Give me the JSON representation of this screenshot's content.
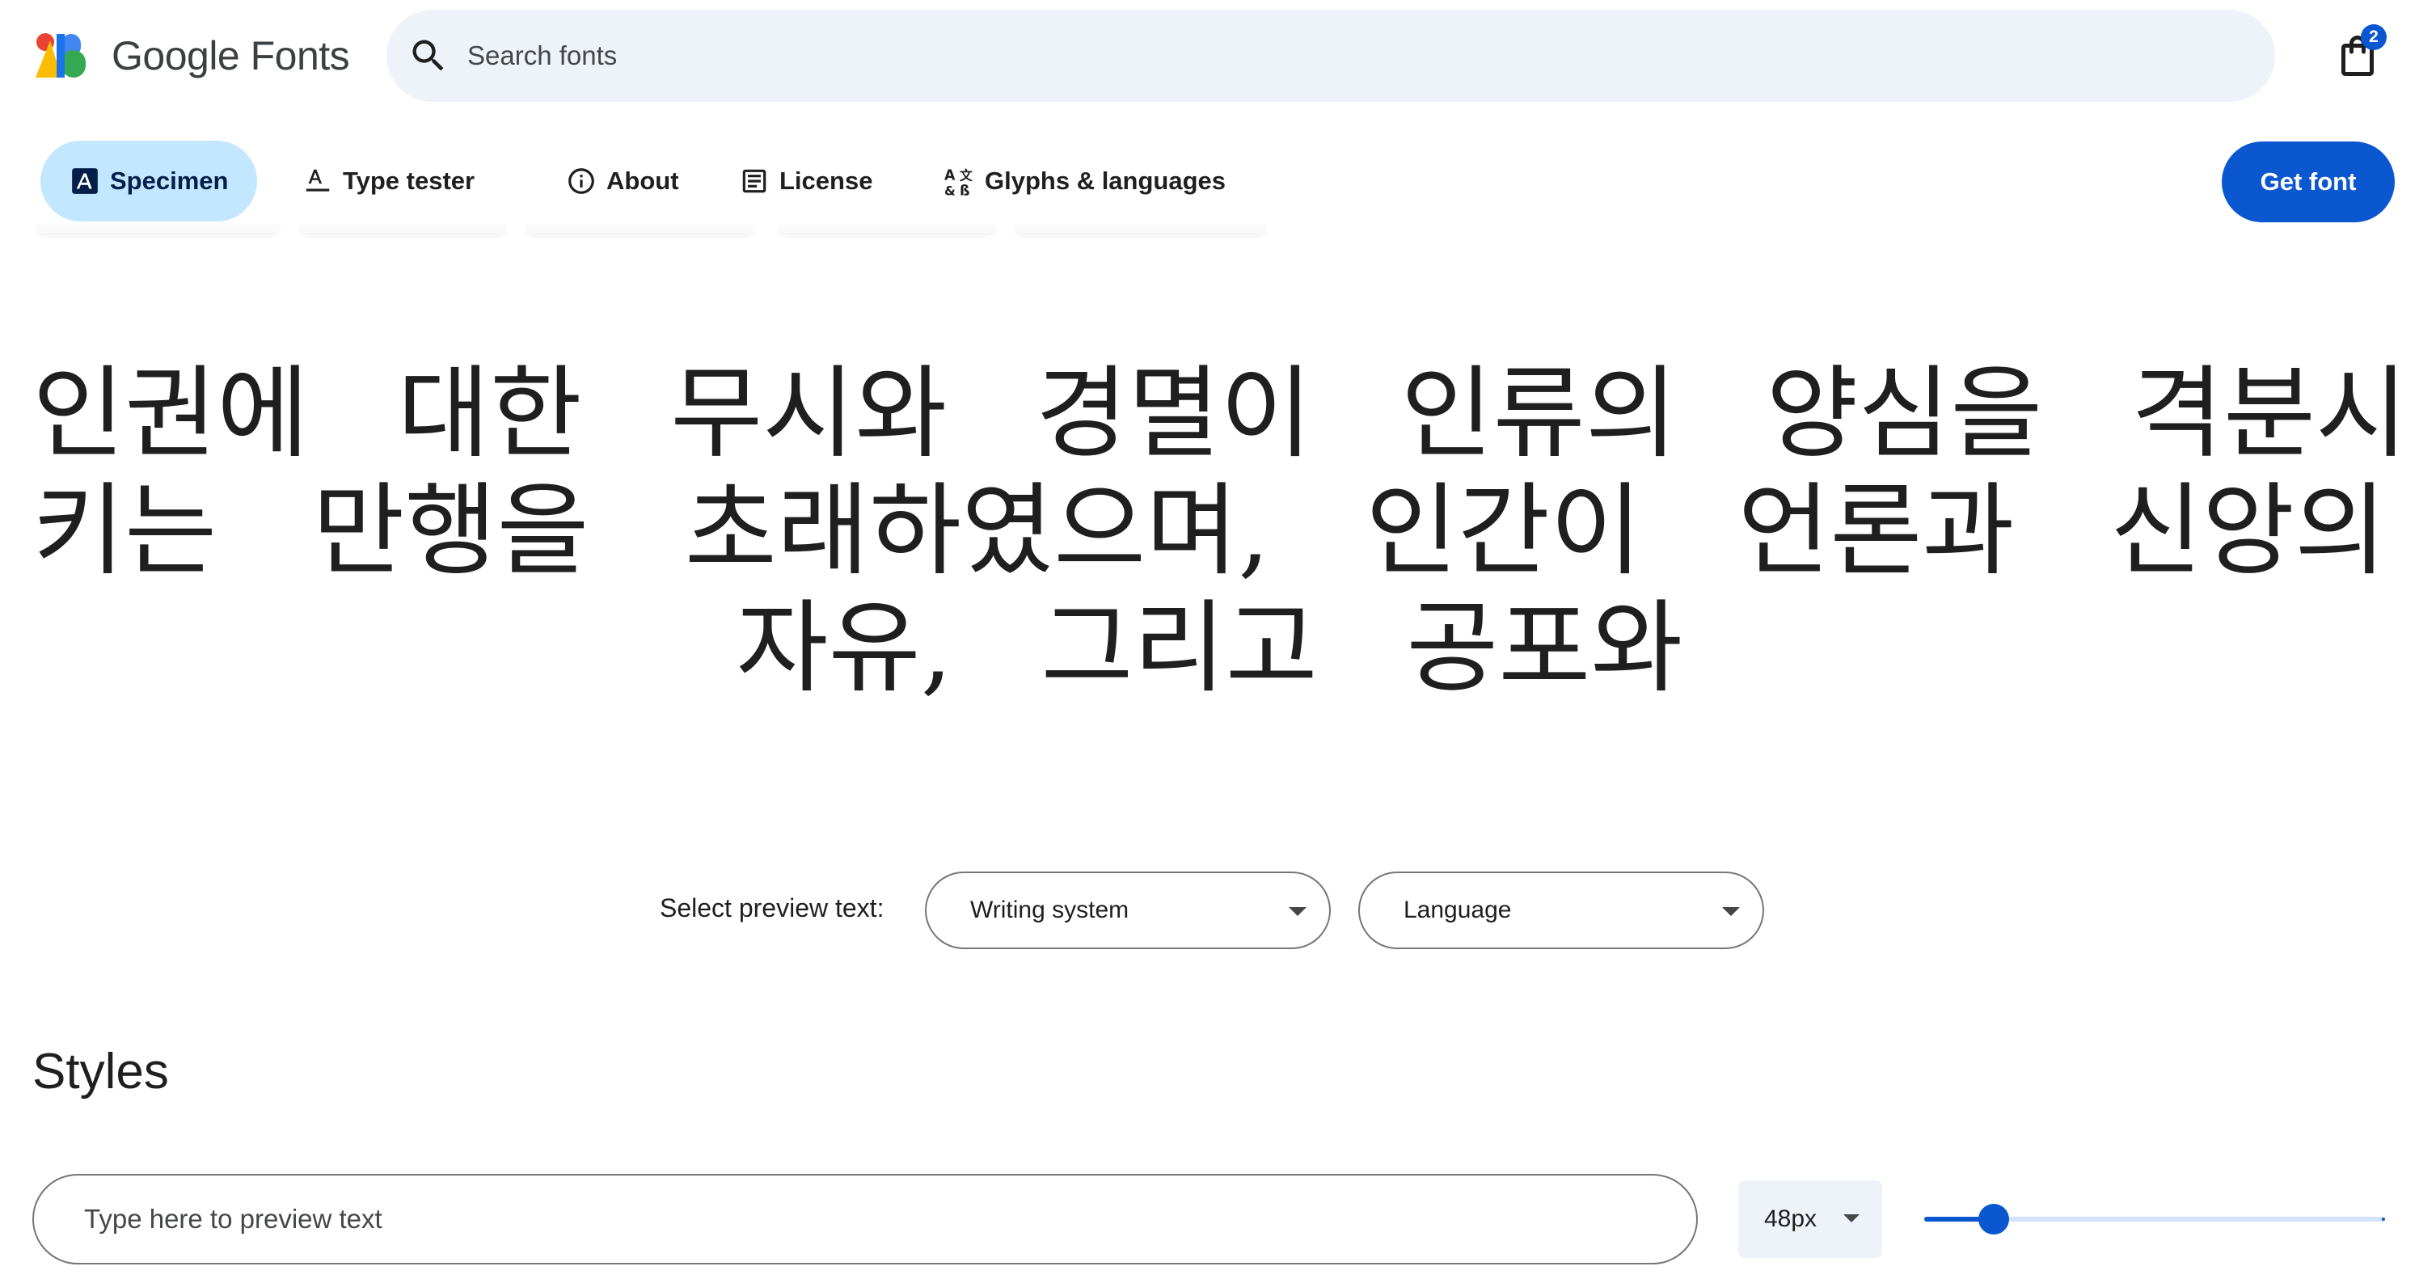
{
  "app": {
    "name": "Google Fonts",
    "logo_icon": "google-fonts-logo",
    "colors": {
      "accent": "#0b57d0",
      "active_tab": "#c2e7ff",
      "search_bg": "#eef2f9"
    }
  },
  "search": {
    "placeholder": "Search fonts",
    "icon": "search-icon"
  },
  "cart": {
    "icon": "shopping-bag-icon",
    "count": "2"
  },
  "tabs": [
    {
      "label": "Specimen",
      "icon": "specimen-icon",
      "active": true
    },
    {
      "label": "Type tester",
      "icon": "type-tester-icon",
      "active": false
    },
    {
      "label": "About",
      "icon": "info-icon",
      "active": false
    },
    {
      "label": "License",
      "icon": "license-icon",
      "active": false
    },
    {
      "label": "Glyphs & languages",
      "icon": "glyphs-icon",
      "active": false
    }
  ],
  "get_font": {
    "label": "Get font"
  },
  "specimen": {
    "lines": [
      "인권에 대한 무시와 경멸이 인류의 양심을 격분시",
      "키는 만행을 초래하였으며, 인간이 언론과 신앙의",
      "자유, 그리고 공포와"
    ]
  },
  "preview_select": {
    "label": "Select preview text:",
    "writing_system": "Writing system",
    "language": "Language"
  },
  "styles": {
    "title": "Styles",
    "preview_placeholder": "Type here to preview text",
    "size": "48px",
    "slider_fraction": 0.15
  }
}
